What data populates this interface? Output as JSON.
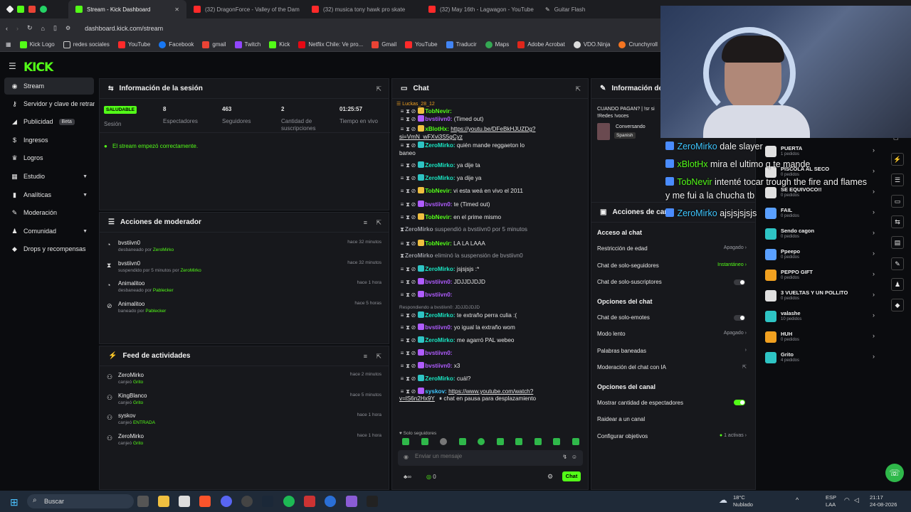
{
  "browser": {
    "tabs": [
      {
        "label": "Stream - Kick Dashboard",
        "active": true
      },
      {
        "label": "(32) DragonForce - Valley of the Dam"
      },
      {
        "label": "(32) musica tony hawk pro skate"
      },
      {
        "label": "(32) May 16th - Lagwagon - YouTube"
      },
      {
        "label": "Guitar Flash"
      }
    ],
    "url": "dashboard.kick.com/stream",
    "bookmarks": [
      "Kick Logo",
      "redes sociales",
      "YouTube",
      "Facebook",
      "gmail",
      "Twitch",
      "Kick",
      "Netflix Chile: Ve pro...",
      "Gmail",
      "YouTube",
      "Traducir",
      "Maps",
      "Adobe Acrobat",
      "VDO.Ninja",
      "Crunchyroll"
    ]
  },
  "app": {
    "logo": "KICK"
  },
  "sidebar": {
    "items": [
      {
        "label": "Stream",
        "icon": "broadcast-icon"
      },
      {
        "label": "Servidor y clave de retransmisión",
        "icon": "key-icon"
      },
      {
        "label": "Publicidad",
        "icon": "megaphone-icon",
        "badge": "Beta"
      },
      {
        "label": "Ingresos",
        "icon": "dollar-icon"
      },
      {
        "label": "Logros",
        "icon": "trophy-icon"
      },
      {
        "label": "Estudio",
        "icon": "grid-icon"
      },
      {
        "label": "Analíticas",
        "icon": "chart-icon"
      },
      {
        "label": "Moderación",
        "icon": "wrench-icon"
      },
      {
        "label": "Comunidad",
        "icon": "users-icon"
      },
      {
        "label": "Drops y recompensas",
        "icon": "drop-icon"
      }
    ]
  },
  "session": {
    "title": "Información de la sesión",
    "status": "SALUDABLE",
    "status_label": "Sesión",
    "viewers": "8",
    "viewers_label": "Espectadores",
    "followers": "463",
    "followers_label": "Seguidores",
    "subs": "2",
    "subs_label": "Cantidad de suscripciones",
    "uptime": "01:25:57",
    "uptime_label": "Tiempo en vivo",
    "message": "El stream empezó correctamente."
  },
  "mod_actions": {
    "title": "Acciones de moderador",
    "rows": [
      {
        "name": "bvstiivn0",
        "action": "desbaneado por",
        "by": "ZeroMirko",
        "time": "hace 32 minutos"
      },
      {
        "name": "bvstiivn0",
        "action": "suspendido por 5 minutos por",
        "by": "ZeroMirko",
        "time": "hace 32 minutos"
      },
      {
        "name": "Animalitoo",
        "action": "desbaneado por",
        "by": "Pablecker",
        "time": "hace 1 hora"
      },
      {
        "name": "Animalitoo",
        "action": "baneado por",
        "by": "Pablecker",
        "time": "hace 5 horas"
      }
    ]
  },
  "activity": {
    "title": "Feed de actividades",
    "rows": [
      {
        "name": "ZeroMirko",
        "action": "canjeó",
        "item": "Grito",
        "time": "hace 2 minutos"
      },
      {
        "name": "KingBlanco",
        "action": "canjeó",
        "item": "Grito",
        "time": "hace 5 minutos"
      },
      {
        "name": "syskov",
        "action": "canjeó",
        "item": "ENTRADA",
        "time": "hace 1 hora"
      },
      {
        "name": "ZeroMirko",
        "action": "canjeó",
        "item": "Grito",
        "time": "hace 1 hora"
      }
    ]
  },
  "chat": {
    "title": "Chat",
    "pinned_user": "Luckas_28_12",
    "lines": [
      {
        "user": "TobNevir",
        "cls": "u-green",
        "text": ""
      },
      {
        "user": "bvstiivn0",
        "cls": "u-purple",
        "text": "(Timed out)"
      },
      {
        "user": "xBlotHx",
        "cls": "u-green",
        "text": "https://youtu.be/DFeBkHJUZDg?"
      },
      {
        "user": "",
        "cls": "",
        "text": "si=VmN_wFXvi3S5gCyz"
      },
      {
        "user": "ZeroMirko",
        "cls": "u-teal",
        "text": "quién mande reggaeton lo"
      },
      {
        "user": "",
        "cls": "",
        "text": "baneo"
      },
      {
        "user": "ZeroMirko",
        "cls": "u-teal",
        "text": "ya dije ta"
      },
      {
        "user": "ZeroMirko",
        "cls": "u-teal",
        "text": "ya dije ya"
      },
      {
        "user": "TobNevir",
        "cls": "u-green",
        "text": "vi esta weá en vivo el 2011"
      },
      {
        "user": "bvstiivn0",
        "cls": "u-purple",
        "text": "te (Timed out)"
      },
      {
        "user": "TobNevir",
        "cls": "u-green",
        "text": "en el prime mismo"
      },
      {
        "user": "ZeroMirko",
        "cls": "",
        "text": "suspendió a bvstiivn0 por 5 minutos"
      },
      {
        "user": "TobNevir",
        "cls": "u-green",
        "text": "LA LA LAAA"
      },
      {
        "user": "ZeroMirko",
        "cls": "",
        "text": "eliminó la suspensión de bvstiivn0"
      },
      {
        "user": "ZeroMirko",
        "cls": "u-teal",
        "text": "jsjsjsjs :*"
      },
      {
        "user": "bvstiivn0",
        "cls": "u-purple",
        "text": "JDJJDJDJD"
      },
      {
        "user": "bvstiivn0",
        "cls": "u-purple",
        "text": ""
      },
      {
        "user": "",
        "cls": "",
        "text": "Respondiendo a bvstiivn0: JDJJDJDJD"
      },
      {
        "user": "ZeroMirko",
        "cls": "u-teal",
        "text": "te extraño perra culia :("
      },
      {
        "user": "bvstiivn0",
        "cls": "u-purple",
        "text": "yo igual la extraño wom"
      },
      {
        "user": "ZeroMirko",
        "cls": "u-teal",
        "text": "me agarró PAL webeo"
      },
      {
        "user": "bvstiivn0",
        "cls": "u-purple",
        "text": ""
      },
      {
        "user": "bvstiivn0",
        "cls": "u-purple",
        "text": "x3"
      },
      {
        "user": "ZeroMirko",
        "cls": "u-teal",
        "text": "cuál?"
      },
      {
        "user": "syskov",
        "cls": "u-blue",
        "text": "https://www.youtube.com/watch?"
      },
      {
        "user": "",
        "cls": "",
        "text": "v=lS6n2Hx9Y"
      }
    ],
    "paused": "chat en pausa para desplazamiento",
    "mode": "Solo seguidores",
    "placeholder": "Enviar un mensaje",
    "count_inf": "∞",
    "count_zero": "0",
    "send": "Chat"
  },
  "info_panel": {
    "title": "Información del stream",
    "stream_title": "CUANDO PAGAN? | !sr si !Redes !voces",
    "category": "Conversando",
    "language": "Spanish"
  },
  "mod_panel": {
    "title": "Acciones de canal",
    "section1": "Acceso al chat",
    "rows1": [
      {
        "label": "Restricción de edad",
        "value": "Apagado"
      },
      {
        "label": "Chat de solo-seguidores",
        "value": "Instantáneo"
      },
      {
        "label": "Chat de solo-suscriptores",
        "value": ""
      }
    ],
    "section2": "Opciones del chat",
    "rows2": [
      {
        "label": "Chat de solo-emotes",
        "value": ""
      },
      {
        "label": "Modo lento",
        "value": "Apagado"
      },
      {
        "label": "Palabras baneadas",
        "value": ""
      },
      {
        "label": "Moderación del chat con IA",
        "value": ""
      }
    ],
    "section3": "Opciones del canal",
    "rows3": [
      {
        "label": "Mostrar cantidad de espectadores",
        "value": ""
      },
      {
        "label": "Raidear a un canal",
        "value": ""
      },
      {
        "label": "Configurar objetivos",
        "value": "1 activas"
      }
    ]
  },
  "rewards": [
    {
      "name": "PUERTA",
      "sub": "1 pedidos",
      "color": "#e0e0e0"
    },
    {
      "name": "PISCOLA AL SECO",
      "sub": "0 pedidos",
      "color": "#e0e0e0"
    },
    {
      "name": "SE EQUIVOCO!!",
      "sub": "0 pedidos",
      "color": "#e0e0e0"
    },
    {
      "name": "FAIL",
      "sub": "0 pedidos",
      "color": "#5aa0ff"
    },
    {
      "name": "Sendo cagon",
      "sub": "0 pedidos",
      "color": "#2ec4c4"
    },
    {
      "name": "Ppeepo",
      "sub": "0 pedidos",
      "color": "#5aa0ff"
    },
    {
      "name": "PEPPO GIFT",
      "sub": "0 pedidos",
      "color": "#f0a020"
    },
    {
      "name": "3 VUELTAS Y UN POLLITO",
      "sub": "0 pedidos",
      "color": "#e0e0e0"
    },
    {
      "name": "valashe",
      "sub": "10 pedidos",
      "color": "#2ec4c4"
    },
    {
      "name": "HUH",
      "sub": "0 pedidos",
      "color": "#f0a020"
    },
    {
      "name": "Grito",
      "sub": "4 pedidos",
      "color": "#2ec4c4"
    }
  ],
  "overlay": [
    {
      "user": "ZeroMirko",
      "cls": "u-blue",
      "text": "dale slayer"
    },
    {
      "user": "xBlotHx",
      "cls": "u-green",
      "text": "mira el ultimo q te mande"
    },
    {
      "user": "TobNevir",
      "cls": "u-green",
      "text": "intenté tocar trough the fire and flames"
    },
    {
      "user": "",
      "cls": "",
      "text": "y me fui a la chucha tb"
    },
    {
      "user": "ZeroMirko",
      "cls": "u-blue",
      "text": "ajsjsjsjsjs"
    }
  ],
  "taskbar": {
    "search": "Buscar",
    "weather": "18°C",
    "weather_desc": "Nublado",
    "lang": "ESP",
    "lang2": "LAA",
    "time": "21:17",
    "date": "24-08-2026"
  },
  "colors": {
    "accent": "#53fc18",
    "panel": "#17181c",
    "bg": "#0b0c0f"
  }
}
